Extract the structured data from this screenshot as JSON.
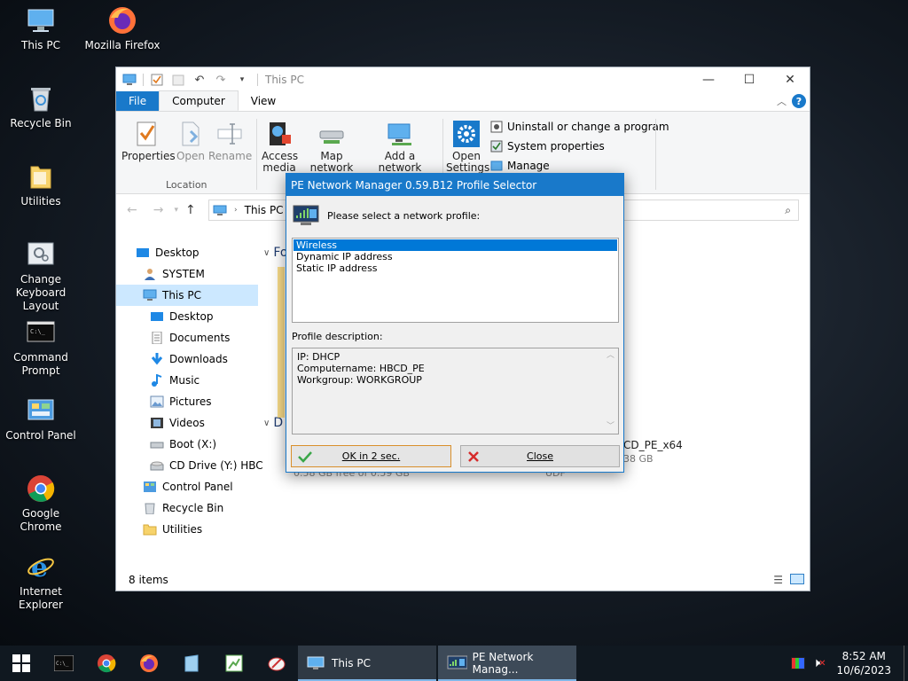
{
  "desktop": {
    "icons": [
      {
        "label": "This PC"
      },
      {
        "label": "Mozilla Firefox"
      },
      {
        "label": "Recycle Bin"
      },
      {
        "label": "Utilities"
      },
      {
        "label": "Change Keyboard Layout"
      },
      {
        "label": "Command Prompt"
      },
      {
        "label": "Control Panel"
      },
      {
        "label": "Google Chrome"
      },
      {
        "label": "Internet Explorer"
      }
    ]
  },
  "explorer": {
    "title": "This PC",
    "tabs": [
      "File",
      "Computer",
      "View"
    ],
    "ribbon": {
      "properties": "Properties",
      "open": "Open",
      "rename": "Rename",
      "location_group": "Location",
      "access_media": "Access media",
      "map_network_drive": "Map network drive",
      "add_network_location": "Add a network location",
      "open_settings": "Open Settings",
      "uninstall": "Uninstall or change a program",
      "system_properties": "System properties",
      "manage": "Manage"
    },
    "address": "This PC",
    "nav_items": [
      {
        "label": "Desktop",
        "icon": "desktop-icon"
      },
      {
        "label": "SYSTEM",
        "icon": "user-icon"
      },
      {
        "label": "This PC",
        "icon": "computer-icon"
      },
      {
        "label": "Desktop",
        "icon": "desktop-icon"
      },
      {
        "label": "Documents",
        "icon": "documents-icon"
      },
      {
        "label": "Downloads",
        "icon": "downloads-icon"
      },
      {
        "label": "Music",
        "icon": "music-icon"
      },
      {
        "label": "Pictures",
        "icon": "pictures-icon"
      },
      {
        "label": "Videos",
        "icon": "videos-icon"
      },
      {
        "label": "Boot (X:)",
        "icon": "drive-icon"
      },
      {
        "label": "CD Drive (Y:) HBC",
        "icon": "cd-drive-icon"
      },
      {
        "label": "Control Panel",
        "icon": "control-panel-icon"
      },
      {
        "label": "Recycle Bin",
        "icon": "recycle-bin-icon"
      },
      {
        "label": "Utilities",
        "icon": "folder-icon"
      }
    ],
    "content": {
      "folders_header": "Fo",
      "devices_header": "D",
      "drive_name": "CD_PE_x64",
      "drive_size": "38 GB",
      "drive_free": "0.58 GB free of 0.59 GB",
      "drive_fs": "UDF"
    },
    "status": "8 items"
  },
  "dialog": {
    "title": "PE Network Manager 0.59.B12 Profile Selector",
    "prompt": "Please select a network profile:",
    "profiles": [
      "Wireless",
      "Dynamic IP address",
      "Static IP address"
    ],
    "desc_label": "Profile description:",
    "desc_lines": [
      "IP: DHCP",
      "Computername: HBCD_PE",
      "Workgroup: WORKGROUP"
    ],
    "ok_label": "OK in 2 sec.",
    "close_label": "Close"
  },
  "taskbar": {
    "tasks": [
      {
        "label": "This PC"
      },
      {
        "label": "PE Network Manag..."
      }
    ],
    "time": "8:52 AM",
    "date": "10/6/2023"
  },
  "colors": {
    "accent": "#1979ca",
    "selection": "#0078d7",
    "nav_selected": "#cce8ff"
  }
}
